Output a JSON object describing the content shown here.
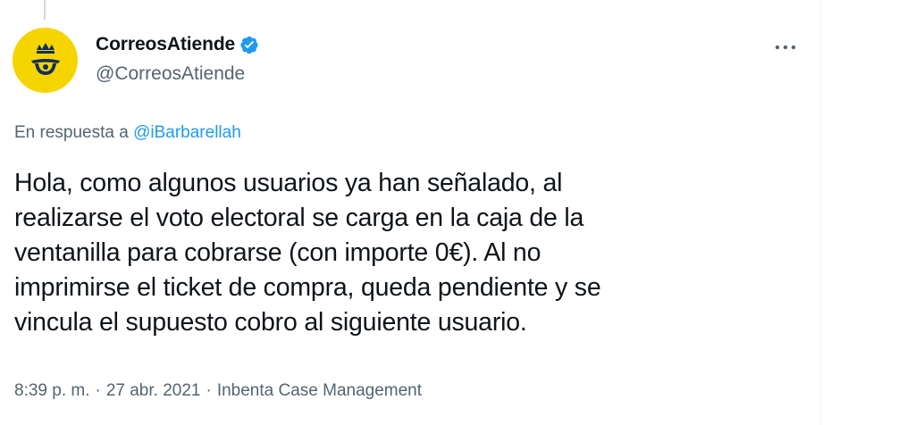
{
  "author": {
    "display_name": "CorreosAtiende",
    "handle": "@CorreosAtiende",
    "verified": true,
    "avatar_icon": "correos-posthorn-crown-icon",
    "avatar_color": "#f6d400"
  },
  "reply_to": {
    "prefix": "En respuesta a",
    "mention": "@iBarbarellah"
  },
  "tweet": {
    "lines": [
      "Hola, como algunos usuarios ya han señalado, al",
      "realizarse el voto electoral se carga en la caja de la",
      "ventanilla para cobrarse (con importe 0€). Al no",
      "imprimirse el ticket de compra, queda pendiente y se",
      "vincula el supuesto cobro al siguiente usuario."
    ]
  },
  "meta": {
    "time": "8:39 p. m.",
    "date": "27 abr. 2021",
    "source": "Inbenta Case Management",
    "separator": "·"
  },
  "colors": {
    "accent": "#1d9bf0",
    "secondary_text": "#536471",
    "primary_text": "#0f1419"
  },
  "icons": {
    "verified": "verified-badge-icon",
    "more": "more-options-icon"
  }
}
